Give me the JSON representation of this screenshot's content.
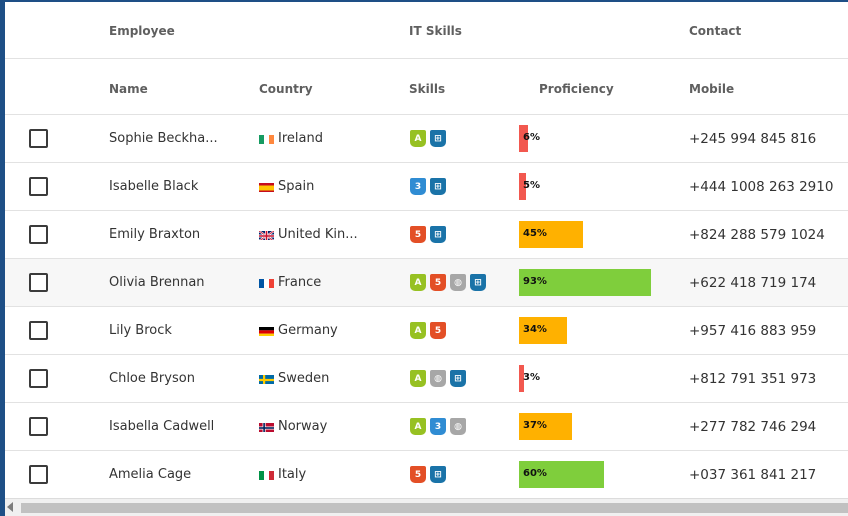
{
  "group_headers": {
    "employee": "Employee",
    "it_skills": "IT Skills",
    "contact": "Contact"
  },
  "column_headers": {
    "name": "Name",
    "country": "Country",
    "skills": "Skills",
    "proficiency": "Proficiency",
    "mobile": "Mobile"
  },
  "colors": {
    "low": "#f2584f",
    "medium": "#ffb100",
    "high": "#7fce3c"
  },
  "rows": [
    {
      "name": "Sophie Beckha...",
      "country": "Ireland",
      "flag": "ireland-flag",
      "skills": [
        "android",
        "windows"
      ],
      "proficiency": 6,
      "proficiency_label": "6%",
      "mobile": "+245 994 845 816"
    },
    {
      "name": "Isabelle Black",
      "country": "Spain",
      "flag": "spain-flag",
      "skills": [
        "css",
        "windows"
      ],
      "proficiency": 5,
      "proficiency_label": "5%",
      "mobile": "+444 1008 263 2910"
    },
    {
      "name": "Emily Braxton",
      "country": "United Kin...",
      "flag": "uk-flag",
      "skills": [
        "html",
        "windows"
      ],
      "proficiency": 45,
      "proficiency_label": "45%",
      "mobile": "+824 288 579 1024"
    },
    {
      "name": "Olivia Brennan",
      "country": "France",
      "flag": "france-flag",
      "skills": [
        "android",
        "html",
        "apple",
        "windows"
      ],
      "proficiency": 93,
      "proficiency_label": "93%",
      "mobile": "+622 418 719 174"
    },
    {
      "name": "Lily Brock",
      "country": "Germany",
      "flag": "germany-flag",
      "skills": [
        "android",
        "html"
      ],
      "proficiency": 34,
      "proficiency_label": "34%",
      "mobile": "+957 416 883 959"
    },
    {
      "name": "Chloe Bryson",
      "country": "Sweden",
      "flag": "sweden-flag",
      "skills": [
        "android",
        "apple",
        "windows"
      ],
      "proficiency": 3,
      "proficiency_label": "3%",
      "mobile": "+812 791 351 973"
    },
    {
      "name": "Isabella Cadwell",
      "country": "Norway",
      "flag": "norway-flag",
      "skills": [
        "android",
        "css",
        "apple"
      ],
      "proficiency": 37,
      "proficiency_label": "37%",
      "mobile": "+277 782 746 294"
    },
    {
      "name": "Amelia Cage",
      "country": "Italy",
      "flag": "italy-flag",
      "skills": [
        "html",
        "windows"
      ],
      "proficiency": 60,
      "proficiency_label": "60%",
      "mobile": "+037 361 841 217"
    }
  ]
}
